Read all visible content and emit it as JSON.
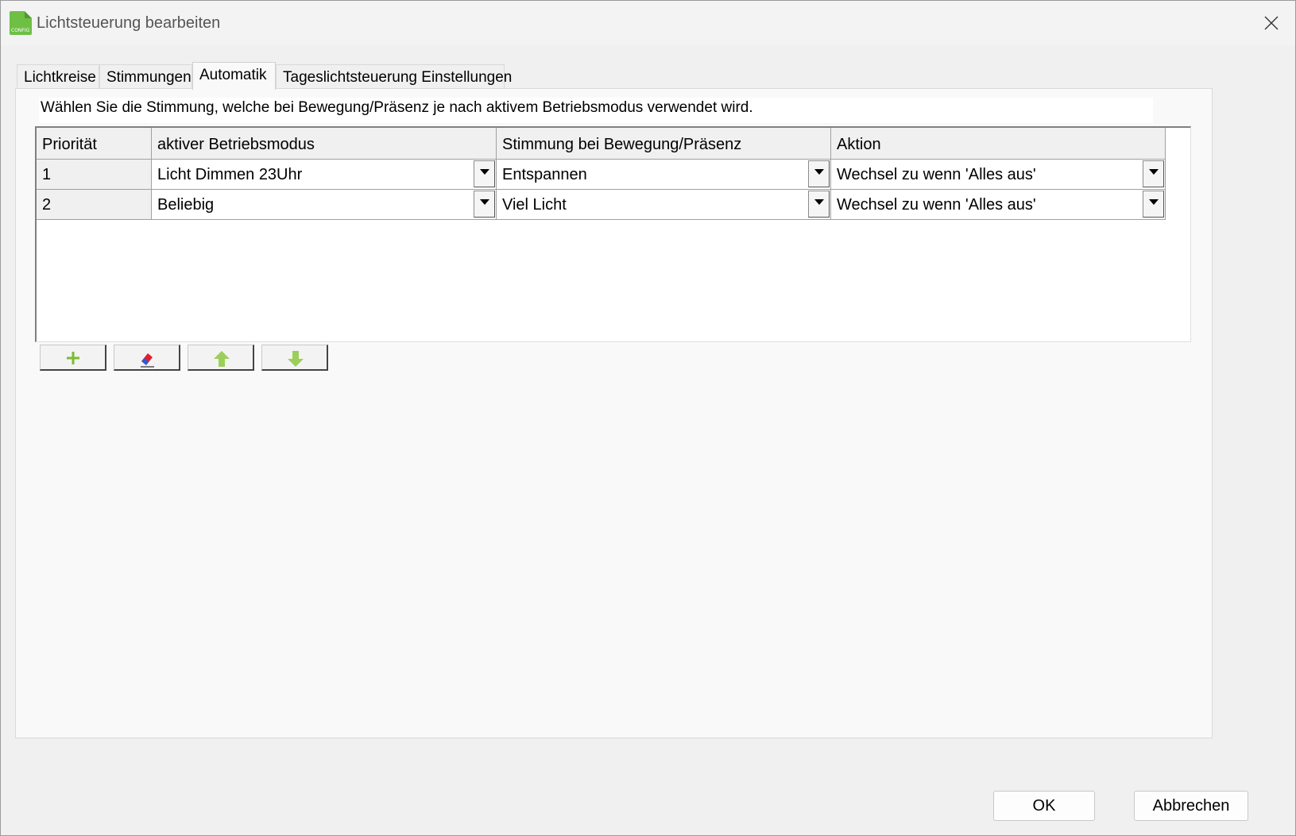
{
  "window": {
    "title": "Lichtsteuerung bearbeiten",
    "app_icon_label": "CONFIG"
  },
  "tabs": [
    {
      "label": "Lichtkreise",
      "active": false
    },
    {
      "label": "Stimmungen",
      "active": false
    },
    {
      "label": "Automatik",
      "active": true
    },
    {
      "label": "Tageslichtsteuerung Einstellungen",
      "active": false
    }
  ],
  "hint": "Wählen Sie die Stimmung, welche bei Bewegung/Präsenz je nach aktivem Betriebsmodus verwendet wird.",
  "table": {
    "headers": [
      "Priorität",
      "aktiver Betriebsmodus",
      "Stimmung bei Bewegung/Präsenz",
      "Aktion"
    ],
    "rows": [
      {
        "prio": "1",
        "modus": "Licht Dimmen 23Uhr",
        "stimmung": "Entspannen",
        "aktion": "Wechsel zu wenn 'Alles aus'"
      },
      {
        "prio": "2",
        "modus": "Beliebig",
        "stimmung": "Viel Licht",
        "aktion": "Wechsel zu wenn 'Alles aus'"
      }
    ]
  },
  "toolbar": {
    "icons": [
      "plus-icon",
      "eraser-icon",
      "arrow-up-icon",
      "arrow-down-icon"
    ],
    "colors": {
      "green": "#8dc63f",
      "eraser_red": "#e0202a",
      "eraser_blue": "#2a5bd7"
    }
  },
  "footer": {
    "ok_label": "OK",
    "cancel_label": "Abbrechen"
  }
}
